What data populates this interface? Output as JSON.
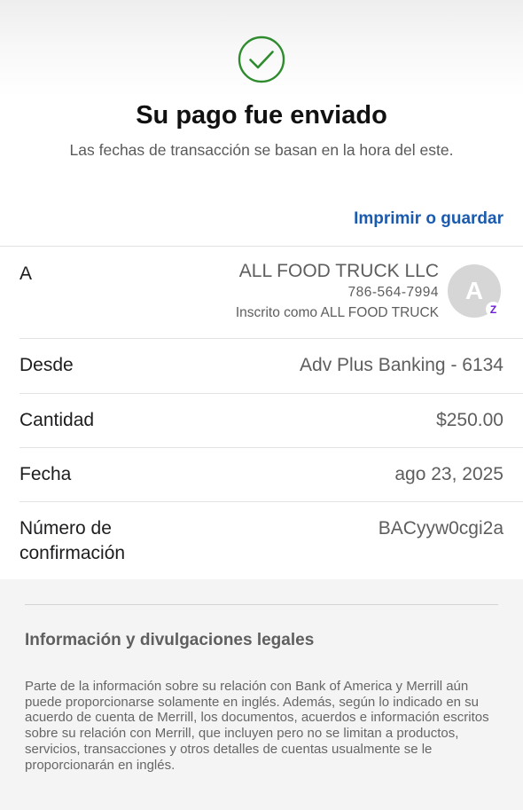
{
  "header": {
    "title": "Su pago fue enviado",
    "subtitle": "Las fechas de transacción se basan en la hora del este.",
    "print_link": "Imprimir o guardar",
    "status_icon": "check-circle-icon",
    "status_color": "#2e8b2e"
  },
  "payee": {
    "label": "A",
    "name": "ALL FOOD TRUCK LLC",
    "phone": "786-564-7994",
    "registered_as": "Inscrito como ALL FOOD TRUCK",
    "avatar_initial": "A",
    "badge_icon": "zelle-icon",
    "badge_glyph": "Z"
  },
  "details": {
    "from": {
      "label": "Desde",
      "value": "Adv Plus Banking - 6134"
    },
    "amount": {
      "label": "Cantidad",
      "value": "$250.00"
    },
    "date": {
      "label": "Fecha",
      "value": "ago 23, 2025"
    },
    "confirmation": {
      "label_line1": "Número de",
      "label_line2": "confirmación",
      "value": "BACyyw0cgi2a"
    }
  },
  "legal": {
    "title": "Información y divulgaciones legales",
    "body": "Parte de la información sobre su relación con Bank of America y Merrill aún puede proporcionarse solamente en inglés. Además, según lo indicado en su acuerdo de cuenta de Merrill, los documentos, acuerdos e información escritos sobre su relación con Merrill, que incluyen pero no se limitan a productos, servicios, transacciones y otros detalles de cuentas usualmente se le proporcionarán en inglés."
  },
  "colors": {
    "link": "#1a5bb0",
    "zelle": "#6d1ed4"
  }
}
